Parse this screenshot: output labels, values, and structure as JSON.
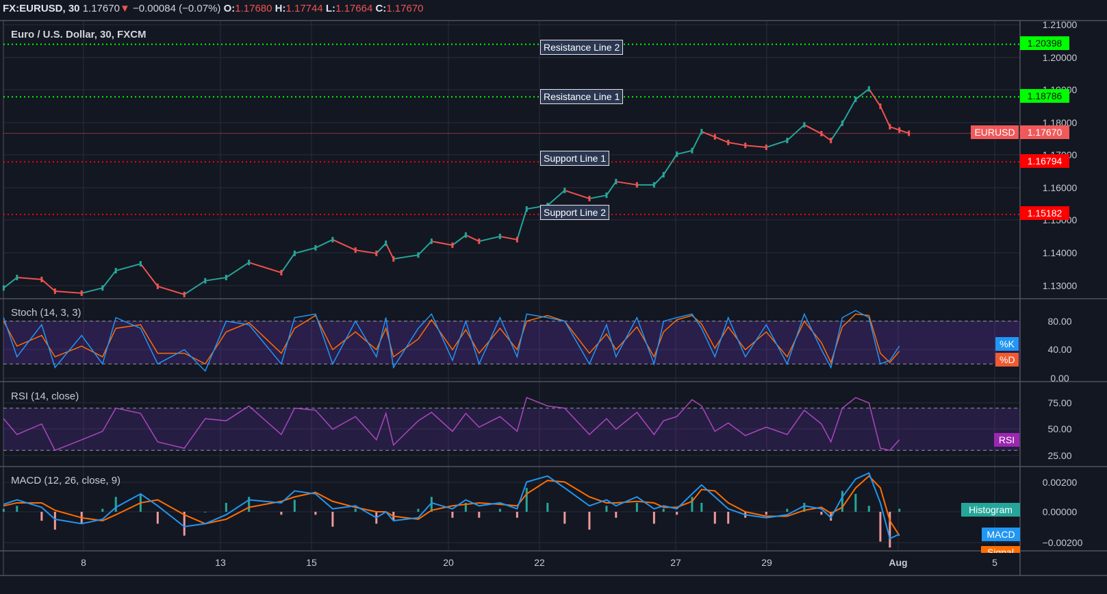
{
  "header": {
    "symbol": "FX:EURUSD, 30",
    "last": "1.17670",
    "change": "−0.00084 (−0.07%)",
    "o_label": "O:",
    "o": "1.17680",
    "h_label": "H:",
    "h": "1.17744",
    "l_label": "L:",
    "l": "1.17664",
    "c_label": "C:",
    "c": "1.17670",
    "direction_icon": "triangle-down-icon"
  },
  "colors": {
    "background": "#131722",
    "grid": "#2a2e39",
    "up": "#26a69a",
    "down": "#ef5350",
    "resistance": "#00ff00",
    "support": "#ff0000",
    "stoch_k": "#2196f3",
    "stoch_d": "#ff6d00",
    "rsi": "#ab47bc",
    "macd": "#2196f3",
    "signal": "#ff6d00",
    "hist_up": "#26a69a",
    "hist_down": "#ef9a9a"
  },
  "chart_data": [
    {
      "type": "line",
      "title": "Euro / U.S. Dollar, 30, FXCM",
      "ylim": [
        1.126,
        1.212
      ],
      "y_ticks": [
        "1.21000",
        "1.20000",
        "1.19000",
        "1.18000",
        "1.17000",
        "1.16000",
        "1.15000",
        "1.14000",
        "1.13000"
      ],
      "grid": true,
      "x": [
        "07-06 06:00",
        "07-06 13:00",
        "07-07 02:00",
        "07-07 09:00",
        "07-07 23:00",
        "07-08 10:00",
        "07-08 17:00",
        "07-09 06:00",
        "07-09 15:00",
        "07-10 05:00",
        "07-10 16:00",
        "07-13 03:00",
        "07-13 15:00",
        "07-14 08:00",
        "07-14 15:00",
        "07-15 02:00",
        "07-15 11:00",
        "07-15 23:00",
        "07-16 10:00",
        "07-16 15:00",
        "07-16 19:00",
        "07-17 08:00",
        "07-17 15:00",
        "07-20 02:00",
        "07-20 09:00",
        "07-20 16:00",
        "07-21 03:00",
        "07-21 12:00",
        "07-21 17:00",
        "07-22 04:00",
        "07-22 13:00",
        "07-23 02:00",
        "07-23 11:00",
        "07-23 16:00",
        "07-24 03:00",
        "07-24 12:00",
        "07-24 17:00",
        "07-27 00:00",
        "07-27 08:00",
        "07-27 13:00",
        "07-27 20:00",
        "07-28 03:00",
        "07-28 12:00",
        "07-28 23:00",
        "07-29 10:00",
        "07-29 19:00",
        "07-30 04:00",
        "07-30 09:00",
        "07-30 15:00",
        "07-30 22:00",
        "07-31 05:00",
        "07-31 11:00",
        "07-31 16:00",
        "07-31 21:00",
        "08-03 02:00"
      ],
      "series": [
        {
          "values": [
            1.1293,
            1.1325,
            1.1319,
            1.1283,
            1.1277,
            1.1293,
            1.1346,
            1.1367,
            1.1298,
            1.1273,
            1.1315,
            1.1325,
            1.1371,
            1.134,
            1.1399,
            1.1416,
            1.1441,
            1.1409,
            1.1399,
            1.143,
            1.1382,
            1.1394,
            1.1436,
            1.1424,
            1.1455,
            1.1436,
            1.1451,
            1.1441,
            1.1535,
            1.1546,
            1.1592,
            1.1567,
            1.1577,
            1.1619,
            1.1609,
            1.1609,
            1.164,
            1.1703,
            1.1714,
            1.1772,
            1.1756,
            1.1739,
            1.173,
            1.1724,
            1.1745,
            1.1793,
            1.1766,
            1.1745,
            1.1798,
            1.1871,
            1.1903,
            1.185,
            1.1787,
            1.1777,
            1.1767
          ]
        }
      ],
      "hlines": [
        {
          "label": "Resistance Line 2",
          "value": "1.20398",
          "kind": "resistance"
        },
        {
          "label": "Resistance Line 1",
          "value": "1.18786",
          "kind": "resistance"
        },
        {
          "label": "Support Line 1",
          "value": "1.16794",
          "kind": "support"
        },
        {
          "label": "Support Line 2",
          "value": "1.15182",
          "kind": "support"
        }
      ],
      "last_price": {
        "label": "EURUSD",
        "value": "1.17670"
      }
    },
    {
      "type": "line",
      "title": "Stoch (14, 3, 3)",
      "ylim": [
        0,
        100
      ],
      "y_ticks": [
        "80.00",
        "40.00",
        "0.00"
      ],
      "band": [
        20,
        80
      ],
      "series": [
        {
          "name": "%K",
          "values": [
            85,
            30,
            75,
            15,
            60,
            20,
            85,
            70,
            20,
            40,
            10,
            80,
            75,
            20,
            85,
            90,
            20,
            80,
            30,
            85,
            15,
            70,
            90,
            25,
            80,
            20,
            85,
            30,
            90,
            85,
            80,
            20,
            75,
            30,
            85,
            20,
            80,
            85,
            90,
            70,
            30,
            85,
            30,
            75,
            20,
            90,
            40,
            15,
            85,
            95,
            85,
            20,
            25,
            45
          ]
        },
        {
          "name": "%D",
          "values": [
            80,
            45,
            60,
            30,
            45,
            30,
            70,
            75,
            35,
            35,
            20,
            65,
            78,
            35,
            70,
            88,
            40,
            65,
            40,
            70,
            30,
            55,
            82,
            40,
            68,
            35,
            70,
            40,
            80,
            88,
            80,
            35,
            62,
            40,
            72,
            30,
            65,
            82,
            88,
            76,
            42,
            72,
            40,
            65,
            30,
            80,
            50,
            22,
            72,
            90,
            88,
            35,
            22,
            38
          ]
        }
      ]
    },
    {
      "type": "line",
      "title": "RSI (14, close)",
      "ylim": [
        20,
        85
      ],
      "y_ticks": [
        "75.00",
        "50.00",
        "25.00"
      ],
      "band": [
        30,
        70
      ],
      "series": [
        {
          "name": "RSI",
          "values": [
            60,
            45,
            55,
            30,
            40,
            48,
            70,
            65,
            38,
            32,
            60,
            58,
            72,
            45,
            70,
            68,
            50,
            62,
            40,
            65,
            35,
            58,
            66,
            48,
            65,
            52,
            62,
            48,
            80,
            72,
            70,
            45,
            60,
            50,
            66,
            45,
            58,
            62,
            78,
            72,
            48,
            56,
            44,
            52,
            45,
            68,
            55,
            38,
            70,
            80,
            75,
            32,
            30,
            40
          ]
        }
      ]
    },
    {
      "type": "line",
      "title": "MACD (12, 26, close, 9)",
      "ylim": [
        -0.0021,
        0.0029
      ],
      "y_ticks": [
        "0.00200",
        "0.00000",
        "−0.00200"
      ],
      "series": [
        {
          "name": "MACD",
          "values": [
            0.0005,
            0.0008,
            0.0003,
            -0.0005,
            -0.0008,
            -0.0005,
            0.0003,
            0.0012,
            0.0004,
            -0.001,
            -0.0008,
            -0.0002,
            0.0008,
            0.0006,
            0.0014,
            0.0012,
            0.0002,
            0.0004,
            -0.0004,
            0.0,
            -0.0006,
            -0.0004,
            0.0006,
            0.0002,
            0.0008,
            0.0004,
            0.0006,
            0.0002,
            0.002,
            0.0024,
            0.0016,
            0.0004,
            0.0008,
            0.0004,
            0.001,
            0.0002,
            0.0004,
            0.0002,
            0.0012,
            0.0018,
            0.001,
            0.0002,
            -0.0002,
            -0.0004,
            -0.0002,
            0.0004,
            0.0002,
            -0.0004,
            0.001,
            0.0022,
            0.0026,
            0.0006,
            -0.0018,
            -0.0015
          ]
        },
        {
          "name": "Signal",
          "values": [
            0.0004,
            0.0006,
            0.0006,
            0.0001,
            -0.0004,
            -0.0006,
            -0.0002,
            0.0006,
            0.0008,
            -0.0002,
            -0.0008,
            -0.0005,
            0.0003,
            0.0007,
            0.001,
            0.0013,
            0.0007,
            0.0003,
            0.0,
            0.0,
            -0.0003,
            -0.0005,
            0.0001,
            0.0004,
            0.0005,
            0.0006,
            0.0005,
            0.0004,
            0.0012,
            0.0021,
            0.002,
            0.001,
            0.0006,
            0.0006,
            0.0007,
            0.0006,
            0.0003,
            0.0003,
            0.0007,
            0.0015,
            0.0014,
            0.0006,
            0.0,
            -0.0003,
            -0.0003,
            0.0001,
            0.0003,
            -0.0001,
            0.0003,
            0.0016,
            0.0024,
            0.0016,
            -0.0006,
            -0.0016
          ]
        },
        {
          "name": "Histogram",
          "values": "MACD − Signal"
        }
      ]
    }
  ],
  "time_axis": {
    "labels": [
      "8",
      "13",
      "15",
      "20",
      "22",
      "27",
      "29",
      "Aug",
      "5"
    ]
  },
  "legends": {
    "k": "%K",
    "d": "%D",
    "rsi": "RSI",
    "histogram": "Histogram",
    "macd": "MACD",
    "signal": "Signal"
  }
}
